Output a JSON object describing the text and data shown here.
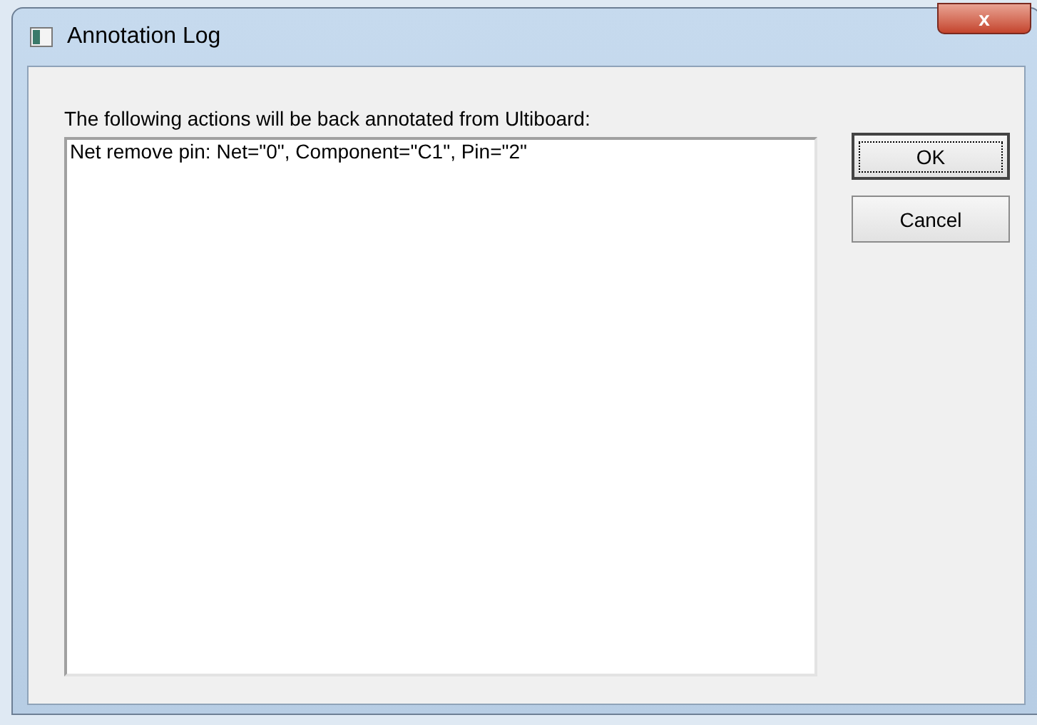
{
  "window": {
    "title": "Annotation Log",
    "close_label": "x"
  },
  "label": "The following actions will be back annotated from Ultiboard:",
  "actions": [
    "Net remove pin: Net=\"0\", Component=\"C1\", Pin=\"2\""
  ],
  "buttons": [
    {
      "label": "OK",
      "selected": true
    },
    {
      "label": "Cancel",
      "selected": false
    }
  ]
}
